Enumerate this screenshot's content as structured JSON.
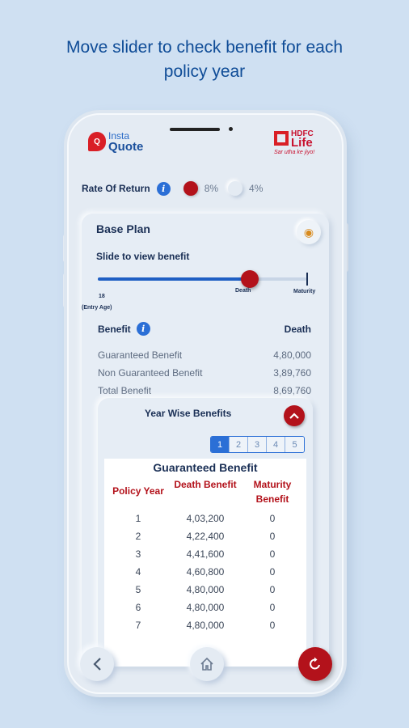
{
  "headline": {
    "line1": "Move slider to check benefit for each",
    "line2": "policy year"
  },
  "brand": {
    "q": "Q",
    "insta": "Insta",
    "quote": "Quote",
    "hdfc": "HDFC",
    "life": "Life",
    "tagline": "Sar utha ke jiyo!"
  },
  "rate_of_return": {
    "label": "Rate Of Return",
    "info": "i",
    "options": [
      {
        "value": "8%",
        "selected": true
      },
      {
        "value": "4%",
        "selected": false
      }
    ]
  },
  "base_plan": {
    "title": "Base Plan",
    "slider": {
      "label": "Slide to view benefit",
      "start_value": "18",
      "start_caption": "(Entry Age)",
      "death_label": "Death",
      "maturity_label": "Maturity",
      "position_fraction": 0.73
    },
    "benefit": {
      "header": "Benefit",
      "column": "Death",
      "rows": [
        {
          "label": "Guaranteed Benefit",
          "value": "4,80,000"
        },
        {
          "label": "Non Guaranteed Benefit",
          "value": "3,89,760"
        },
        {
          "label": "Total Benefit",
          "value": "8,69,760"
        }
      ]
    }
  },
  "year_wise": {
    "title": "Year Wise Benefits",
    "pages": [
      "1",
      "2",
      "3",
      "4",
      "5"
    ],
    "active_page": "1",
    "table_title": "Guaranteed Benefit",
    "headers": {
      "year": "Policy Year",
      "death": "Death Benefit",
      "maturity": "Maturity Benefit"
    },
    "rows": [
      {
        "year": "1",
        "death": "4,03,200",
        "maturity": "0"
      },
      {
        "year": "2",
        "death": "4,22,400",
        "maturity": "0"
      },
      {
        "year": "3",
        "death": "4,41,600",
        "maturity": "0"
      },
      {
        "year": "4",
        "death": "4,60,800",
        "maturity": "0"
      },
      {
        "year": "5",
        "death": "4,80,000",
        "maturity": "0"
      },
      {
        "year": "6",
        "death": "4,80,000",
        "maturity": "0"
      },
      {
        "year": "7",
        "death": "4,80,000",
        "maturity": "0"
      }
    ]
  },
  "nav": {
    "back_icon": "chevron-left-icon",
    "home_icon": "home-icon",
    "reset_icon": "refresh-icon"
  }
}
